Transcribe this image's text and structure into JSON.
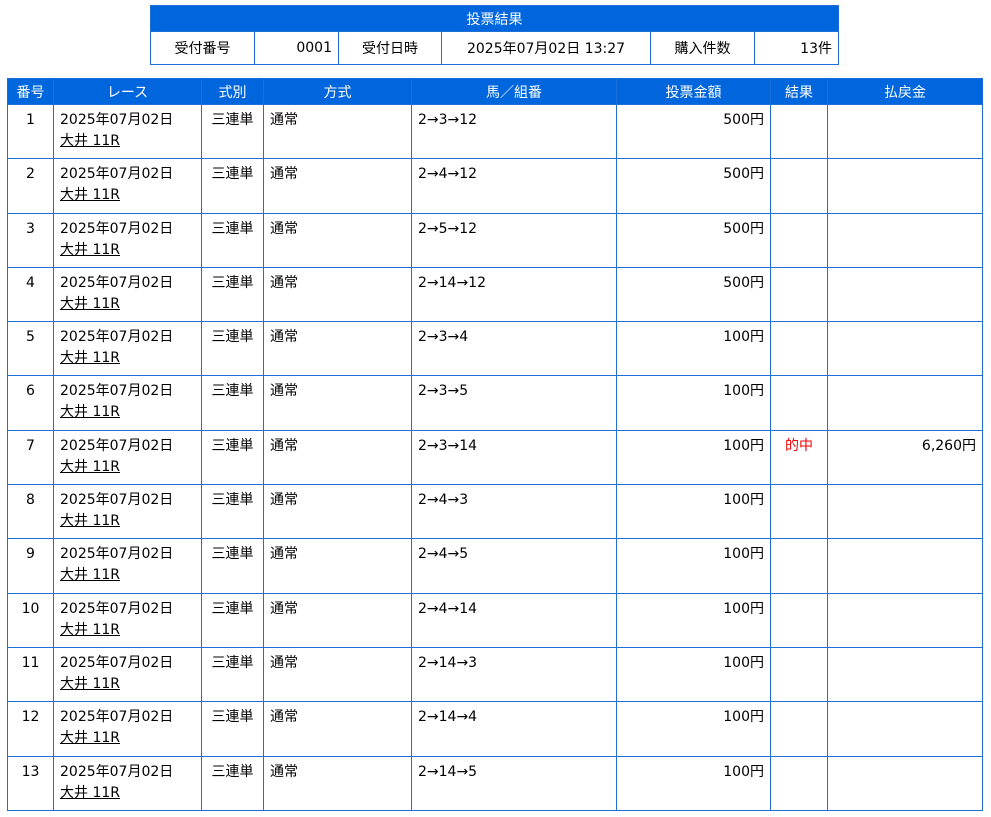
{
  "summary": {
    "title": "投票結果",
    "receipt_number_label": "受付番号",
    "receipt_number": "0001",
    "receipt_datetime_label": "受付日時",
    "receipt_datetime": "2025年07月02日 13:27",
    "purchase_count_label": "購入件数",
    "purchase_count": "13件"
  },
  "columns": [
    "番号",
    "レース",
    "式別",
    "方式",
    "馬／組番",
    "投票金額",
    "結果",
    "払戻金"
  ],
  "rows": [
    {
      "no": "1",
      "date": "2025年07月02日",
      "race": "大井 11R",
      "kind": "三連単",
      "method": "通常",
      "combo": "2→3→12",
      "amount": "500円",
      "result": "",
      "payout": ""
    },
    {
      "no": "2",
      "date": "2025年07月02日",
      "race": "大井 11R",
      "kind": "三連単",
      "method": "通常",
      "combo": "2→4→12",
      "amount": "500円",
      "result": "",
      "payout": ""
    },
    {
      "no": "3",
      "date": "2025年07月02日",
      "race": "大井 11R",
      "kind": "三連単",
      "method": "通常",
      "combo": "2→5→12",
      "amount": "500円",
      "result": "",
      "payout": ""
    },
    {
      "no": "4",
      "date": "2025年07月02日",
      "race": "大井 11R",
      "kind": "三連単",
      "method": "通常",
      "combo": "2→14→12",
      "amount": "500円",
      "result": "",
      "payout": ""
    },
    {
      "no": "5",
      "date": "2025年07月02日",
      "race": "大井 11R",
      "kind": "三連単",
      "method": "通常",
      "combo": "2→3→4",
      "amount": "100円",
      "result": "",
      "payout": ""
    },
    {
      "no": "6",
      "date": "2025年07月02日",
      "race": "大井 11R",
      "kind": "三連単",
      "method": "通常",
      "combo": "2→3→5",
      "amount": "100円",
      "result": "",
      "payout": ""
    },
    {
      "no": "7",
      "date": "2025年07月02日",
      "race": "大井 11R",
      "kind": "三連単",
      "method": "通常",
      "combo": "2→3→14",
      "amount": "100円",
      "result": "的中",
      "payout": "6,260円"
    },
    {
      "no": "8",
      "date": "2025年07月02日",
      "race": "大井 11R",
      "kind": "三連単",
      "method": "通常",
      "combo": "2→4→3",
      "amount": "100円",
      "result": "",
      "payout": ""
    },
    {
      "no": "9",
      "date": "2025年07月02日",
      "race": "大井 11R",
      "kind": "三連単",
      "method": "通常",
      "combo": "2→4→5",
      "amount": "100円",
      "result": "",
      "payout": ""
    },
    {
      "no": "10",
      "date": "2025年07月02日",
      "race": "大井 11R",
      "kind": "三連単",
      "method": "通常",
      "combo": "2→4→14",
      "amount": "100円",
      "result": "",
      "payout": ""
    },
    {
      "no": "11",
      "date": "2025年07月02日",
      "race": "大井 11R",
      "kind": "三連単",
      "method": "通常",
      "combo": "2→14→3",
      "amount": "100円",
      "result": "",
      "payout": ""
    },
    {
      "no": "12",
      "date": "2025年07月02日",
      "race": "大井 11R",
      "kind": "三連単",
      "method": "通常",
      "combo": "2→14→4",
      "amount": "100円",
      "result": "",
      "payout": ""
    },
    {
      "no": "13",
      "date": "2025年07月02日",
      "race": "大井 11R",
      "kind": "三連単",
      "method": "通常",
      "combo": "2→14→5",
      "amount": "100円",
      "result": "",
      "payout": ""
    }
  ],
  "colors": {
    "header_bg": "#0066dd",
    "border": "#1f6fd6",
    "hit_text": "#ee0000"
  }
}
